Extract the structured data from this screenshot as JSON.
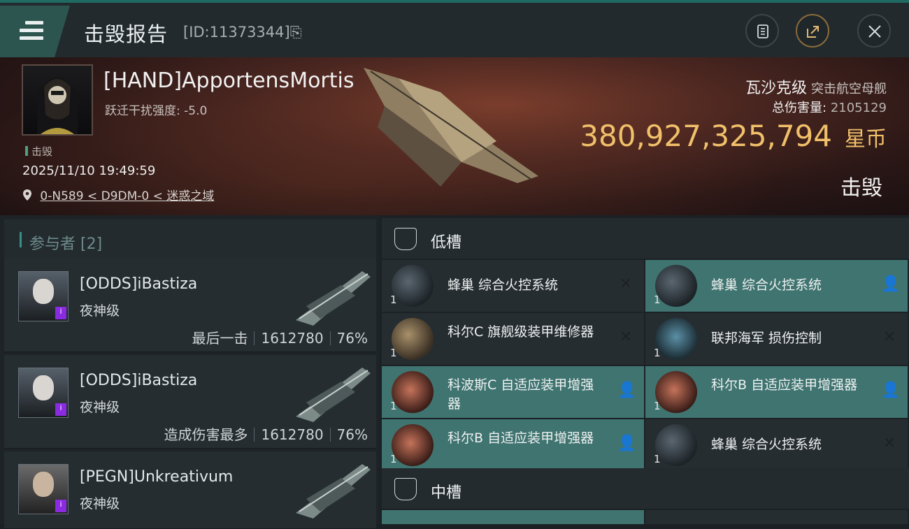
{
  "header": {
    "title": "击毁报告",
    "id_text": "[ID:11373344]",
    "copy_glyph": "⎘"
  },
  "banner": {
    "pilot_name": "[HAND]ApportensMortis",
    "warp_label": "跃迁干扰强度:",
    "warp_value": "-5.0",
    "kill_tag": "击毁",
    "datetime": "2025/11/10 19:49:59",
    "location": "0-N589 < D9DM-0 < 迷惑之域",
    "ship_class": "瓦沙克级",
    "ship_type": "突击航空母舰",
    "damage_label": "总伤害量:",
    "damage_value": "2105129",
    "isk_value": "380,927,325,794",
    "isk_unit": "星币",
    "status": "击毁"
  },
  "participants": {
    "title": "参与者 [2]",
    "rows": [
      {
        "name": "[ODDS]iBastiza",
        "ship": "夜神级",
        "label": "最后一击",
        "damage": "1612780",
        "percent": "76%"
      },
      {
        "name": "[ODDS]iBastiza",
        "ship": "夜神级",
        "label": "造成伤害最多",
        "damage": "1612780",
        "percent": "76%"
      },
      {
        "name": "[PEGN]Unkreativum",
        "ship": "夜神级",
        "label": "",
        "damage": "",
        "percent": ""
      }
    ]
  },
  "fitting": {
    "low_slots_title": "低槽",
    "mid_slots_title": "中槽",
    "low": [
      {
        "name": "蜂巢 综合火控系统",
        "qty": "1",
        "state": "destroyed"
      },
      {
        "name": "蜂巢 综合火控系统",
        "qty": "1",
        "state": "dropped"
      },
      {
        "name": "科尔C 旗舰级装甲维修器",
        "qty": "1",
        "state": "destroyed"
      },
      {
        "name": "联邦海军 损伤控制",
        "qty": "1",
        "state": "destroyed"
      },
      {
        "name": "科波斯C 自适应装甲增强器",
        "qty": "1",
        "state": "dropped"
      },
      {
        "name": "科尔B 自适应装甲增强器",
        "qty": "1",
        "state": "dropped"
      },
      {
        "name": "科尔B 自适应装甲增强器",
        "qty": "1",
        "state": "dropped"
      },
      {
        "name": "蜂巢 综合火控系统",
        "qty": "1",
        "state": "destroyed"
      }
    ],
    "icons": {
      "destroyed": "✕",
      "dropped": "person-icon"
    }
  },
  "colors": {
    "accent": "#3f7470",
    "isk": "#f1c06a",
    "header_accent": "#1f6a62"
  }
}
